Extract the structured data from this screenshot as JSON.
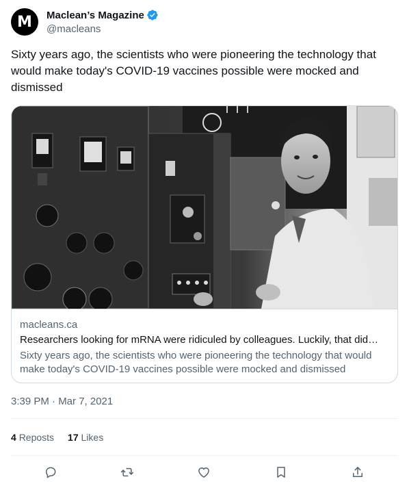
{
  "author": {
    "avatar_letter": "M",
    "display_name": "Maclean’s Magazine",
    "handle": "@macleans",
    "verified": true
  },
  "tweet": {
    "text": "Sixty years ago, the scientists who were pioneering the technology that would make today's COVID-19 vaccines possible were mocked and dismissed",
    "timestamp": "3:39 PM · Mar 7, 2021"
  },
  "card": {
    "domain": "macleans.ca",
    "title": "Researchers looking for mRNA were ridiculed by colleagues. Luckily, that did…",
    "description": "Sixty years ago, the scientists who were pioneering the technology that would make today's COVID-19 vaccines possible were mocked and dismissed"
  },
  "stats": {
    "reposts_count": "4",
    "reposts_label": "Reposts",
    "likes_count": "17",
    "likes_label": "Likes"
  },
  "actions": [
    "reply-icon",
    "repost-icon",
    "like-icon",
    "bookmark-icon",
    "share-icon"
  ],
  "colors": {
    "text": "#0f1419",
    "secondary": "#536471",
    "border": "#cfd9de",
    "verified": "#1d9bf0"
  }
}
